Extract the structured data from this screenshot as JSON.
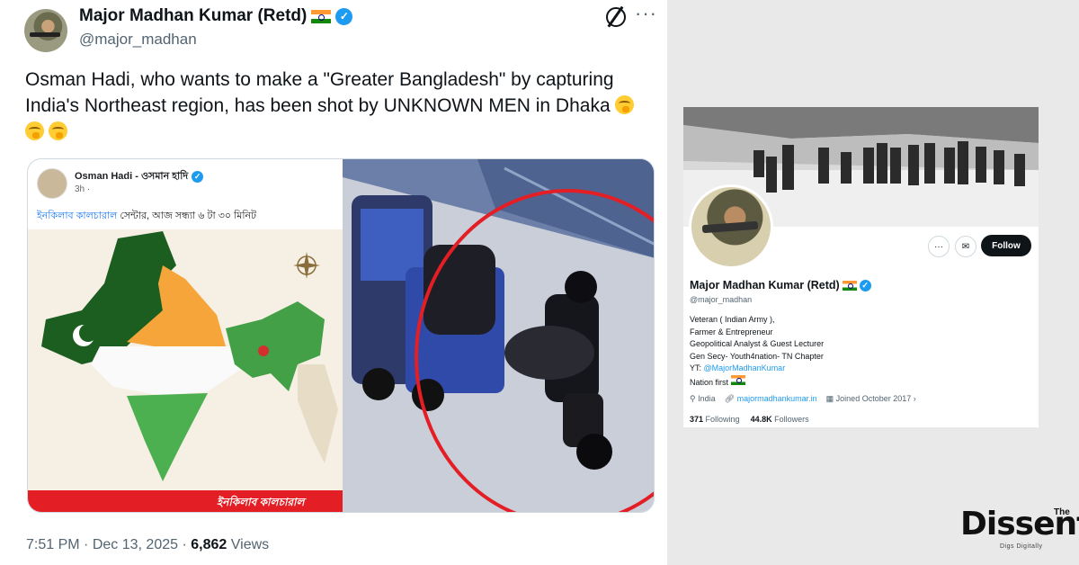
{
  "tweet": {
    "author_name": "Major Madhan Kumar (Retd)",
    "verified_mark": "✓",
    "handle": "@major_madhan",
    "more_label": "···",
    "text": "Osman Hadi, who wants to make a \"Greater Bangladesh\" by capturing India's Northeast region, has been shot by UNKNOWN MEN in Dhaka",
    "time": "7:51 PM",
    "date": "Dec 13, 2025",
    "separator": "·",
    "views_count": "6,862",
    "views_label": "Views",
    "icons": [
      "grok-icon",
      "more-icon",
      "verified-icon",
      "flag-india-icon",
      "emoji-icon"
    ]
  },
  "embedded_post": {
    "author": "Osman Hadi - ওসমান হাদি",
    "time": "3h ·",
    "line_blue": "ইনকিলাব কালচারাল",
    "line_rest": " সেন্টার, আজ সন্ধ্যা ৬ টা ৩০ মিনিট",
    "banner": "ইনকিলাব কালচারাল"
  },
  "profile": {
    "name": "Major Madhan Kumar (Retd)",
    "handle": "@major_madhan",
    "follow_label": "Follow",
    "bio": [
      "Veteran ( Indian Army ),",
      "Farmer & Entrepreneur",
      "Geopolitical Analyst & Guest Lecturer",
      "Gen Secy- Youth4nation- TN Chapter"
    ],
    "yt_prefix": "YT: ",
    "yt_link": "@MajorMadhanKumar",
    "nation": "Nation first",
    "location": "India",
    "website": "majormadhankumar.in",
    "joined": "Joined October 2017",
    "following_count": "371",
    "following_label": "Following",
    "followers_count": "44.8K",
    "followers_label": "Followers"
  },
  "watermark": {
    "word": "Dissent",
    "the": "The",
    "tagline": "Digs Digitally"
  },
  "colors": {
    "accent": "#1d9bf0",
    "text": "#0f1419",
    "muted": "#536471",
    "red": "#e31e24"
  }
}
